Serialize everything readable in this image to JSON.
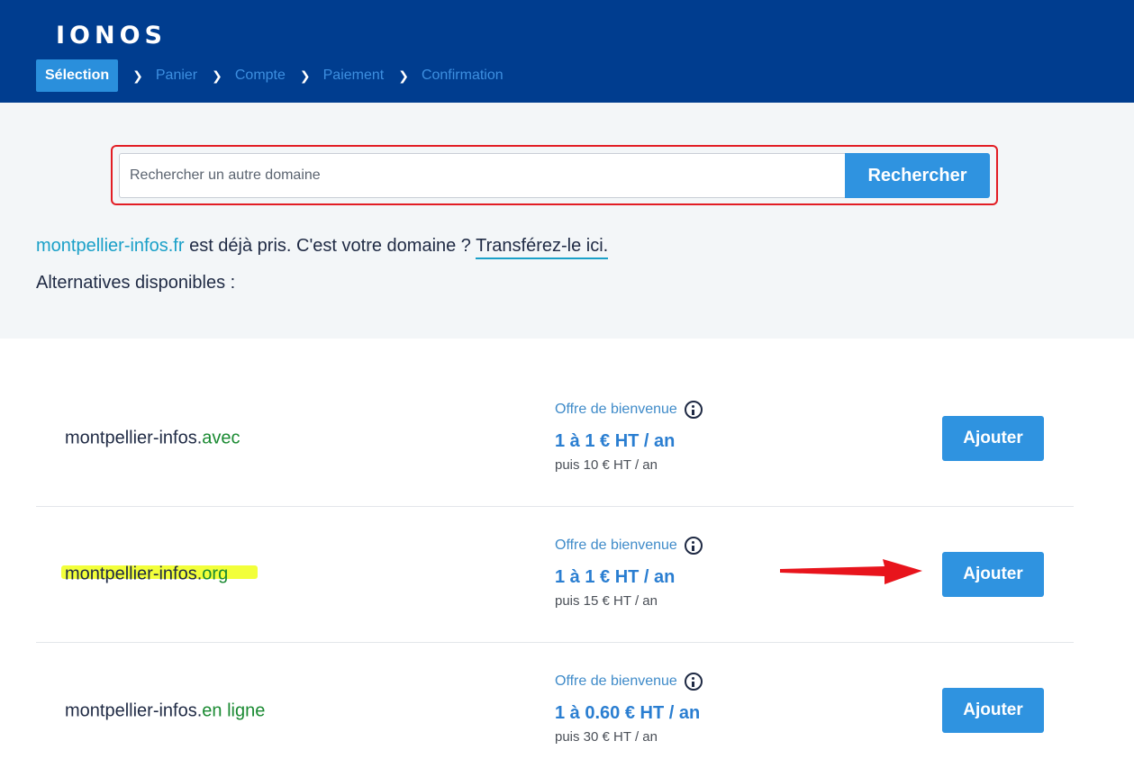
{
  "brand": "IONOS",
  "steps": [
    {
      "label": "Sélection",
      "active": true
    },
    {
      "label": "Panier"
    },
    {
      "label": "Compte"
    },
    {
      "label": "Paiement"
    },
    {
      "label": "Confirmation"
    }
  ],
  "search": {
    "placeholder": "Rechercher un autre domaine",
    "value": "",
    "button_label": "Rechercher"
  },
  "message": {
    "taken_domain": "montpellier-infos.fr",
    "taken_text": " est déjà pris. C'est votre domaine ? ",
    "transfer_link": "Transférez-le ici.",
    "alternatives_title": "Alternatives disponibles :"
  },
  "results": [
    {
      "name": "montpellier-infos.",
      "tld": "avec",
      "offer_label": "Offre de bienvenue",
      "price": "1 à 1 € HT / an",
      "renewal": "puis 10 € HT / an",
      "button_label": "Ajouter",
      "highlighted": false
    },
    {
      "name": "montpellier-infos.",
      "tld": "org",
      "offer_label": "Offre de bienvenue",
      "price": "1 à 1 € HT / an",
      "renewal": "puis 15 € HT / an",
      "button_label": "Ajouter",
      "highlighted": true
    },
    {
      "name": "montpellier-infos.",
      "tld": "en ligne",
      "offer_label": "Offre de bienvenue",
      "price": "1 à 0.60 € HT / an",
      "renewal": "puis 30 € HT / an",
      "button_label": "Ajouter",
      "highlighted": false
    }
  ],
  "colors": {
    "header": "#003d8f",
    "accent": "#2f93e0",
    "tld": "#1a8a32",
    "annotation": "#e21d24",
    "highlight": "#f2ff3a"
  },
  "icons": [
    "chevron-right-icon",
    "info-icon",
    "arrow-annotation"
  ]
}
